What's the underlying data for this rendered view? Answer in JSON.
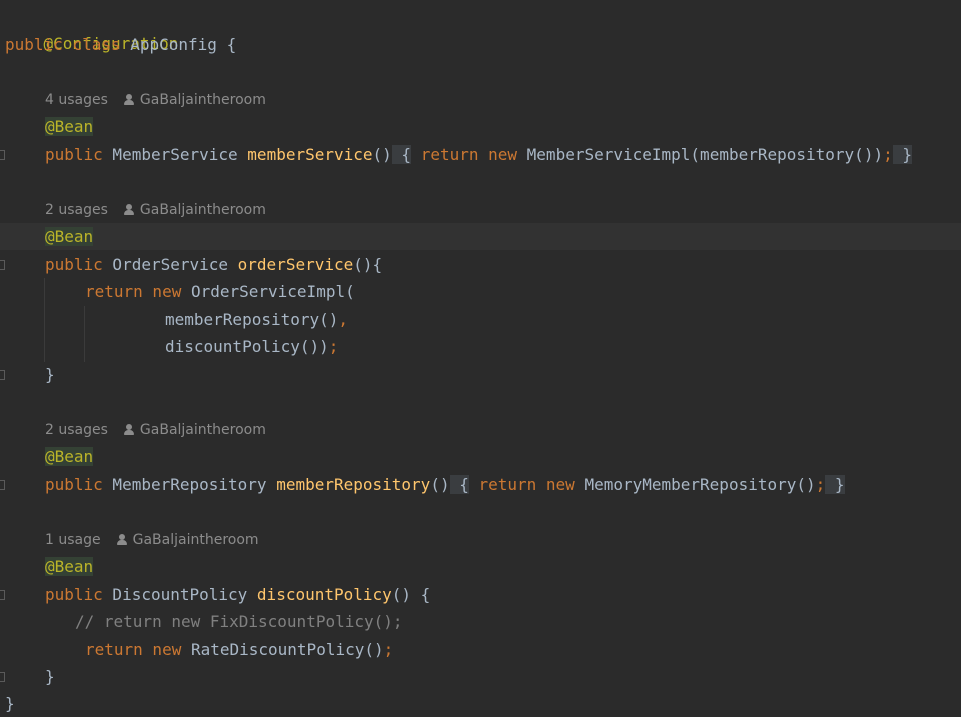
{
  "code": {
    "annotation_configuration": "@Configuration",
    "class_decl": {
      "kw_public": "public",
      "kw_class": "class",
      "name": " AppConfig {"
    },
    "bean_annotation": "@Bean",
    "methods": [
      {
        "hint_usages": "4 usages",
        "hint_author": "GaBaljaintheroom",
        "kw_public": "public",
        "return_type": " MemberService ",
        "name": "memberService",
        "params": "()",
        "fold_open": " {",
        "kw_return": " return",
        "kw_new": " new",
        "expr": " MemberServiceImpl(memberRepository())",
        "semicolon": ";",
        "fold_close": " }"
      },
      {
        "hint_usages": "2 usages",
        "hint_author": "GaBaljaintheroom",
        "kw_public": "public",
        "return_type": " OrderService ",
        "name": "orderService",
        "params": "(){",
        "body": {
          "kw_return": "return",
          "kw_new": " new",
          "ctor": " OrderServiceImpl(",
          "arg1": "memberRepository()",
          "arg1_comma": ",",
          "arg2": "discountPolicy())",
          "arg2_semicolon": ";"
        },
        "close": "}"
      },
      {
        "hint_usages": "2 usages",
        "hint_author": "GaBaljaintheroom",
        "kw_public": "public",
        "return_type": " MemberRepository ",
        "name": "memberRepository",
        "params": "()",
        "fold_open": " {",
        "kw_return": " return",
        "kw_new": " new",
        "expr": " MemoryMemberRepository()",
        "semicolon": ";",
        "fold_close": " }"
      },
      {
        "hint_usages": "1 usage",
        "hint_author": "GaBaljaintheroom",
        "kw_public": "public",
        "return_type": " DiscountPolicy ",
        "name": "discountPolicy",
        "params": "() {",
        "comment": "// return new FixDiscountPolicy();",
        "kw_return": "return",
        "kw_new": " new",
        "expr": " RateDiscountPolicy()",
        "semicolon": ";",
        "close": "}"
      }
    ],
    "class_close": "}"
  },
  "colors": {
    "background": "#2b2b2b",
    "keyword": "#cc7832",
    "annotation": "#bbb529",
    "method_name": "#ffc66d",
    "plain": "#a9b7c6",
    "comment": "#808080",
    "hint": "#8c8c8c"
  }
}
